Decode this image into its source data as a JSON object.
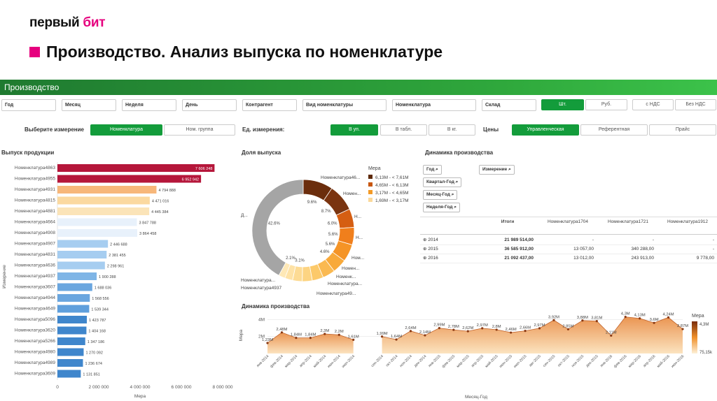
{
  "header": {
    "logo": "первый",
    "logo_tail": "бит",
    "title": "Производство. Анализ выпуска по номенклатуре"
  },
  "app": {
    "title": "Производство"
  },
  "filters": [
    "Год",
    "Месяц",
    "Неделя",
    "День",
    "Контрагент",
    "Вид номенклатуры",
    "Номенклатура",
    "Склад"
  ],
  "unit_toggle": {
    "active": "Шт.",
    "options": [
      "Шт.",
      "Руб."
    ]
  },
  "vat_toggle": {
    "options": [
      "с НДС",
      "Без НДС"
    ]
  },
  "dimension": {
    "label": "Выберите измерение",
    "options": [
      "Номенклатура",
      "Ном. группа"
    ],
    "active": "Номенклатура"
  },
  "units": {
    "label": "Ед. измерения:",
    "options": [
      "В уп.",
      "В табл.",
      "В кг."
    ],
    "active": "В уп."
  },
  "prices": {
    "label": "Цены",
    "options": [
      "Управленческая",
      "Референтная",
      "Прайс"
    ],
    "active": "Управленческая"
  },
  "colors": {
    "accent": "#139c3b",
    "bar_top": "#b5163a",
    "brand": "#e6007e"
  },
  "chart_data": [
    {
      "type": "bar",
      "title": "Выпуск продукции",
      "xlabel": "Мера",
      "ylabel": "Измерение",
      "orientation": "horizontal",
      "categories": [
        "Номенклатура4863",
        "Номенклатура4955",
        "Номенклатура4931",
        "Номенклатура4815",
        "Номенклатура4881",
        "Номенклатура4664",
        "Номенклатура4908",
        "Номенклатура4907",
        "Номенклатура4831",
        "Номенклатура4636",
        "Номенклатура4937",
        "Номенклатура3607",
        "Номенклатура4944",
        "Номенклатура4649",
        "Номенклатура5096",
        "Номенклатура3620",
        "Номенклатура5266",
        "Номенклатура4980",
        "Номенклатура4989",
        "Номенклатура3609"
      ],
      "values": [
        7606248,
        6952942,
        4794888,
        4471016,
        4445384,
        3847788,
        3864458,
        2446688,
        2381455,
        2298961,
        1900288,
        1688036,
        1568556,
        1539344,
        1423787,
        1404168,
        1347186,
        1270092,
        1236674,
        1131851
      ],
      "labels": [
        "7 606 248",
        "6 952 942",
        "4 794 888",
        "4 471 016",
        "4 445 384",
        "3 847 788",
        "3 864 458",
        "2 446 688",
        "2 381 455",
        "2 298 961",
        "1 900 288",
        "1 688 036",
        "1 568 556",
        "1 539 344",
        "1 423 787",
        "1 404 168",
        "1 347 186",
        "1 270 092",
        "1 236 674",
        "1 131 851"
      ],
      "xticks": [
        "0",
        "2 000 000",
        "4 000 000",
        "6 000 000",
        "8 000 000"
      ],
      "xlim": [
        0,
        8000000
      ]
    },
    {
      "type": "pie",
      "title": "Доля выпуска",
      "legend_title": "Мера",
      "legend": [
        "6,13M - < 7,61M",
        "4,65M - < 6,13M",
        "3,17M - < 4,65M",
        "1,69M - < 3,17M"
      ],
      "legend_colors": [
        "#5e2a0a",
        "#c8570f",
        "#f39a26",
        "#fbd99a"
      ],
      "slices": [
        {
          "label": "Номенклатура46...",
          "value": 9.6,
          "pct": "9.6%",
          "color": "#6b2d0c"
        },
        {
          "label": "Номен...",
          "value": 8.7,
          "pct": "8.7%",
          "color": "#7a3410"
        },
        {
          "label": "Н...",
          "value": 6.0,
          "pct": "6.0%",
          "color": "#d55e12"
        },
        {
          "label": "Н...",
          "value": 5.6,
          "pct": "5.6%",
          "color": "#f07f1c"
        },
        {
          "label": "Ном...",
          "value": 5.6,
          "pct": "5.6%",
          "color": "#f59426"
        },
        {
          "label": "Номен...",
          "value": 4.6,
          "pct": "4.6%",
          "color": "#f8a93a"
        },
        {
          "label": "Номенк...",
          "value": 4.0,
          "pct": "",
          "color": "#fab951"
        },
        {
          "label": "Номенклатура...",
          "value": 3.6,
          "pct": "",
          "color": "#fcc96a"
        },
        {
          "label": "Номенклатура49...",
          "value": 3.2,
          "pct": "",
          "color": "#fdd482"
        },
        {
          "label": "Номенклатура4831",
          "value": 3.1,
          "pct": "3.1%",
          "color": "#fddb94"
        },
        {
          "label": "Номенклатура4937",
          "value": 2.5,
          "pct": "",
          "color": "#fee2a6"
        },
        {
          "label": "Номенклатура...",
          "value": 2.1,
          "pct": "2.1%",
          "color": "#fee8b6"
        },
        {
          "label": "Д...",
          "value": 42.6,
          "pct": "42.6%",
          "color": "#a5a5a5"
        }
      ]
    },
    {
      "type": "table",
      "title": "Динамика производства",
      "row_chips": [
        "Год",
        "Квартал-Год",
        "Месяц-Год",
        "Неделя-Год"
      ],
      "col_chip": "Измерение",
      "columns": [
        "Итоги",
        "Номенклатура1704",
        "Номенклатура1721",
        "Номенклатура1912"
      ],
      "rows": [
        {
          "year": "2014",
          "total": "21 989 514,00",
          "c1": "-",
          "c2": "-",
          "c3": "-"
        },
        {
          "year": "2015",
          "total": "36 585 912,00",
          "c1": "13 057,00",
          "c2": "340 288,00",
          "c3": "-"
        },
        {
          "year": "2016",
          "total": "21 092 437,00",
          "c1": "13 012,00",
          "c2": "243 913,00",
          "c3": "9 778,00"
        }
      ]
    },
    {
      "type": "area",
      "title": "Динамика производства",
      "ylabel": "Мера",
      "xlabel": "Месяц-Год",
      "yticks": [
        "2M",
        "4M"
      ],
      "ylim": [
        0,
        4.6
      ],
      "legend_title": "Мера",
      "legend_min": "75,15k",
      "legend_max": "4,3M",
      "x": [
        "янв-2014",
        "фев-2014",
        "мар-2014",
        "апр-2014",
        "май-2014",
        "июн-2014",
        "июл-2014",
        "авг-2014",
        "сен-2014",
        "окт-2014",
        "ноя-2014",
        "дек-2014",
        "янв-2015",
        "фев-2015",
        "мар-2015",
        "апр-2015",
        "май-2015",
        "июн-2015",
        "июл-2015",
        "авг-2015",
        "сен-2015",
        "окт-2015",
        "ноя-2015",
        "дек-2015",
        "янв-2016",
        "фев-2016",
        "мар-2016",
        "апр-2016",
        "май-2016",
        "июн-2016"
      ],
      "values": [
        1.23,
        2.48,
        1.84,
        1.84,
        2.3,
        2.2,
        1.61,
        null,
        1.99,
        1.64,
        2.64,
        2.14,
        2.99,
        2.78,
        2.62,
        2.97,
        2.8,
        2.46,
        2.66,
        2.97,
        3.92,
        2.85,
        3.88,
        3.81,
        2.11,
        4.3,
        4.13,
        3.6,
        4.24,
        2.87
      ],
      "labels": [
        "1,23M",
        "2,48M",
        "1,84M",
        "1,84M",
        "2,3M",
        "2,2M",
        "1,61M",
        "",
        "1,99M",
        "1,64M",
        "2,64M",
        "2,14M",
        "2,99M",
        "2,78M",
        "2,62M",
        "2,97M",
        "2,8M",
        "2,46M",
        "2,66M",
        "2,97M",
        "3,92M",
        "2,85M",
        "3,88M",
        "3,81M",
        "2,11M",
        "4,3M",
        "4,13M",
        "3,6M",
        "4,24M",
        "2,87M"
      ]
    }
  ]
}
